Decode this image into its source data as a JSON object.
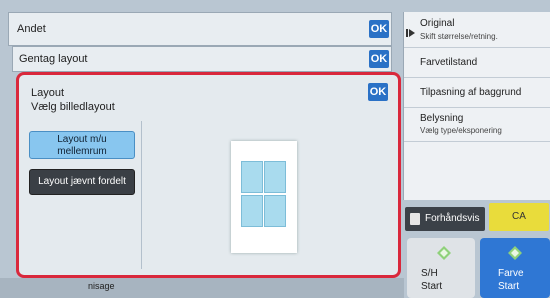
{
  "panels": {
    "andet": {
      "label": "Andet",
      "ok": "OK"
    },
    "gentag": {
      "label": "Gentag layout",
      "ok": "OK"
    },
    "layout": {
      "title": "Layout",
      "subtitle": "Vælg billedlayout",
      "ok": "OK",
      "options": [
        {
          "label_line1": "Layout m/u",
          "label_line2": "mellemrum",
          "selected": true
        },
        {
          "label": "Layout jævnt fordelt",
          "selected": false
        }
      ]
    }
  },
  "right_menu": [
    {
      "title": "Original",
      "subtitle": "Skift størrelse/retning."
    },
    {
      "title": "Farvetilstand"
    },
    {
      "title": "Tilpasning af baggrund"
    },
    {
      "title": "Belysning",
      "subtitle": "Vælg type/eksponering"
    }
  ],
  "actions": {
    "preview": "Forhåndsvis",
    "ca": "CA",
    "start_bw": {
      "line1": "S/H",
      "line2": "Start"
    },
    "start_color": {
      "line1": "Farve",
      "line2": "Start"
    }
  },
  "bottom": {
    "label": "nisage"
  },
  "colors": {
    "ok_blue": "#2a71c6",
    "highlight_red": "#d9283c",
    "selected_blue": "#88c6ef",
    "ca_yellow": "#e9dc3b",
    "start_blue": "#2f77d4"
  },
  "icons": [
    "arrow-right-icon",
    "preview-icon",
    "start-diamond-icon"
  ]
}
